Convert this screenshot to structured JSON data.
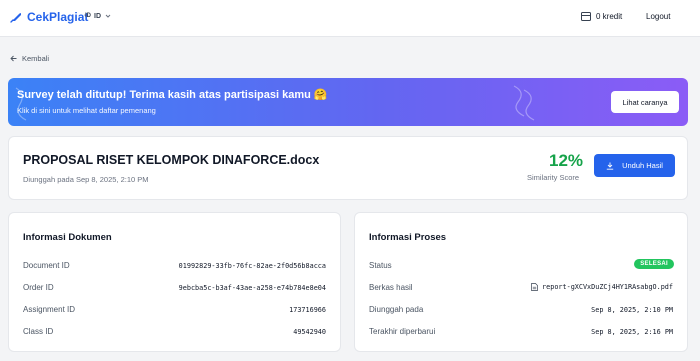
{
  "brand": {
    "name": "CekPlagiat",
    "color": "#2563eb"
  },
  "language": {
    "flag": "ID",
    "code": "ID"
  },
  "header": {
    "credit": "0 kredit",
    "logout": "Logout"
  },
  "nav": {
    "back": "Kembali"
  },
  "banner": {
    "title": "Survey telah ditutup! Terima kasih atas partisipasi kamu 🤗",
    "subtitle": "Klik di sini untuk melihat daftar pemenang",
    "button": "Lihat caranya"
  },
  "document": {
    "title": "PROPOSAL RISET KELOMPOK DINAFORCE.docx",
    "uploaded": "Diunggah pada Sep 8, 2025, 2:10 PM",
    "similarity": "12%",
    "similarity_label": "Similarity Score",
    "download": "Unduh Hasil"
  },
  "doc_info": {
    "title": "Informasi Dokumen",
    "rows": [
      {
        "label": "Document ID",
        "value": "01992829-33fb-76fc-82ae-2f0d56b8acca"
      },
      {
        "label": "Order ID",
        "value": "9ebcba5c-b3af-43ae-a258-e74b784e8e04"
      },
      {
        "label": "Assignment ID",
        "value": "173716966"
      },
      {
        "label": "Class ID",
        "value": "49542940"
      }
    ]
  },
  "process_info": {
    "title": "Informasi Proses",
    "status_label": "Status",
    "status": "SELESAI",
    "file_label": "Berkas hasil",
    "file": "report-gXCVxDuZCj4HY1RAsabgO.pdf",
    "uploaded_label": "Diunggah pada",
    "uploaded": "Sep 8, 2025, 2:10 PM",
    "updated_label": "Terakhir diperbarui",
    "updated": "Sep 8, 2025, 2:16 PM"
  },
  "colors": {
    "accent": "#2563eb",
    "success": "#16a34a",
    "badge": "#22c55e"
  }
}
